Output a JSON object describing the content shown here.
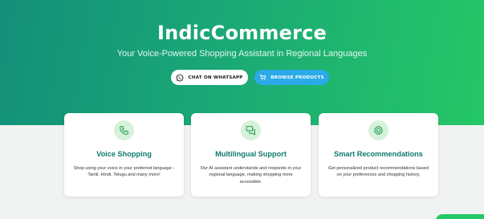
{
  "hero": {
    "title": "IndicCommerce",
    "subtitle": "Your Voice-Powered Shopping Assistant in Regional Languages",
    "gradient": [
      "#138f79",
      "#25c766"
    ]
  },
  "buttons": {
    "whatsapp": {
      "label": "CHAT ON WHATSAPP",
      "icon": "whatsapp-icon"
    },
    "browse": {
      "label": "BROWSE PRODUCTS",
      "icon": "cart-icon",
      "color": "#2aaae8"
    }
  },
  "features": [
    {
      "icon": "phone-icon",
      "title": "Voice Shopping",
      "description": "Shop using your voice in your preferred language - Tamil, Hindi, Telugu and many more!"
    },
    {
      "icon": "chat-icon",
      "title": "Multilingual Support",
      "description": "Our AI assistant understands and responds in your regional language, making shopping more accessible."
    },
    {
      "icon": "target-icon",
      "title": "Smart Recommendations",
      "description": "Get personalized product recommendations based on your preferences and shopping history."
    }
  ],
  "colors": {
    "accent": "#25c766",
    "card_title": "#0f7a6d",
    "icon_bg": "#d6f2da"
  }
}
